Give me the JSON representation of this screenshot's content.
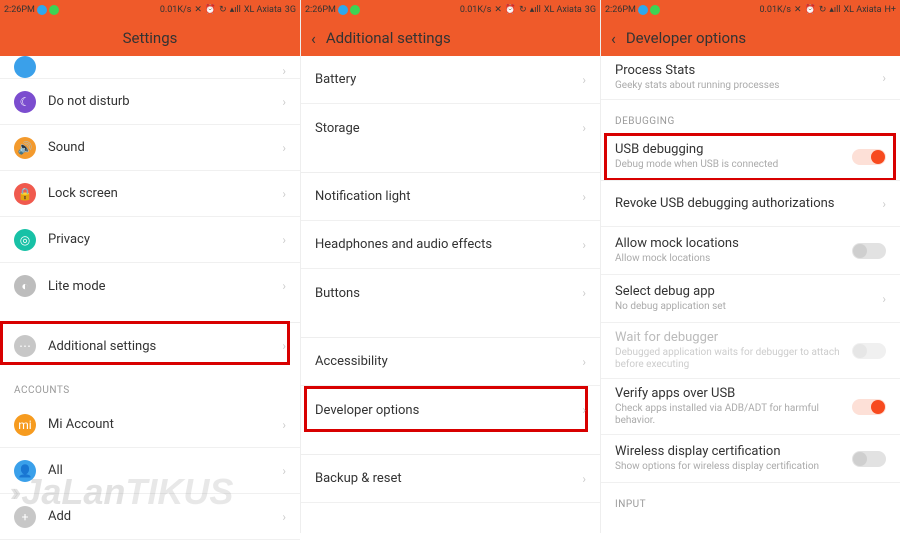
{
  "status": {
    "time": "2:26PM",
    "speed": "0.01K/s",
    "carrier": "XL Axiata",
    "net1": "3G",
    "net2": "H+"
  },
  "panel1": {
    "title": "Settings",
    "items": [
      {
        "label": "Do not disturb"
      },
      {
        "label": "Sound"
      },
      {
        "label": "Lock screen"
      },
      {
        "label": "Privacy"
      },
      {
        "label": "Lite mode"
      },
      {
        "label": "Additional settings"
      }
    ],
    "section_accounts": "ACCOUNTS",
    "accounts": [
      {
        "label": "Mi Account"
      },
      {
        "label": "All"
      },
      {
        "label": "Add"
      }
    ]
  },
  "panel2": {
    "title": "Additional settings",
    "items1": [
      {
        "label": "Battery"
      },
      {
        "label": "Storage"
      }
    ],
    "items2": [
      {
        "label": "Notification light"
      },
      {
        "label": "Headphones and audio effects"
      },
      {
        "label": "Buttons"
      }
    ],
    "items3": [
      {
        "label": "Accessibility"
      },
      {
        "label": "Developer options"
      }
    ],
    "items4": [
      {
        "label": "Backup & reset"
      }
    ]
  },
  "panel3": {
    "title": "Developer options",
    "process": {
      "label": "Process Stats",
      "sub": "Geeky stats about running processes"
    },
    "section_debugging": "DEBUGGING",
    "usb": {
      "label": "USB debugging",
      "sub": "Debug mode when USB is connected"
    },
    "revoke": {
      "label": "Revoke USB debugging authorizations"
    },
    "mock": {
      "label": "Allow mock locations",
      "sub": "Allow mock locations"
    },
    "selectdbg": {
      "label": "Select debug app",
      "sub": "No debug application set"
    },
    "wait": {
      "label": "Wait for debugger",
      "sub": "Debugged application waits for debugger to attach before executing"
    },
    "verify": {
      "label": "Verify apps over USB",
      "sub": "Check apps installed via ADB/ADT for harmful behavior."
    },
    "wireless": {
      "label": "Wireless display certification",
      "sub": "Show options for wireless display certification"
    },
    "section_input": "INPUT"
  },
  "watermark": {
    "text1": "JaLan",
    "text2": "TIKUS"
  }
}
